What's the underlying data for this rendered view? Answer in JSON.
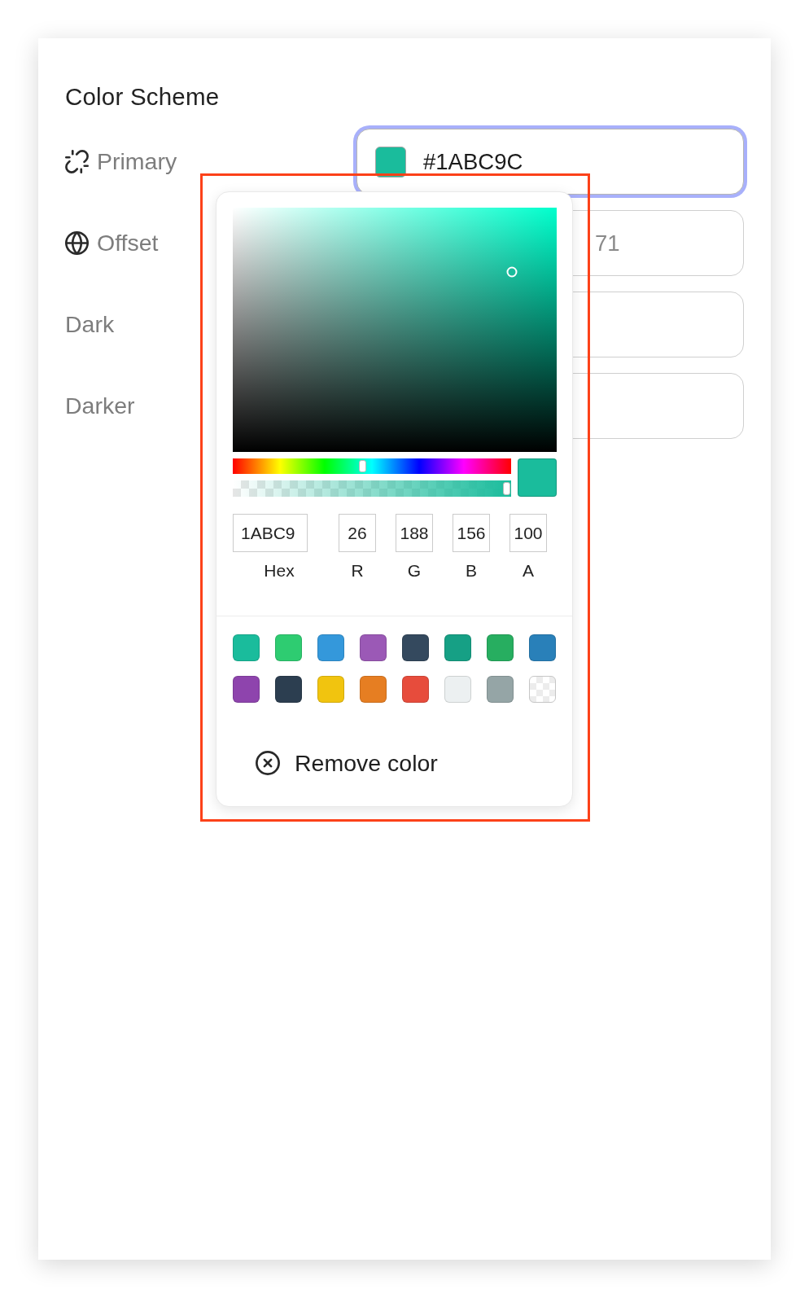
{
  "title": "Color Scheme",
  "fields": [
    {
      "label": "Primary",
      "focused": true,
      "color": "#1abc9c",
      "value": "#1ABC9C"
    },
    {
      "label": "Offset",
      "focused": false,
      "placeholder": "71"
    },
    {
      "label": "Dark",
      "focused": false
    },
    {
      "label": "Darker",
      "focused": false
    }
  ],
  "color_picker": {
    "hue": {
      "level": 0.467
    },
    "alpha": {
      "level": 1
    },
    "inputs": [
      {
        "kind": "hex",
        "value": "1ABC9",
        "label": "Hex"
      },
      {
        "kind": "channel",
        "value": "26",
        "label": "R"
      },
      {
        "kind": "channel",
        "value": "188",
        "label": "G"
      },
      {
        "kind": "channel",
        "value": "156",
        "label": "B"
      },
      {
        "kind": "channel",
        "value": "100",
        "label": "A"
      }
    ],
    "swatches": [
      {
        "kind": "solid",
        "color": "#1abc9c"
      },
      {
        "kind": "solid",
        "color": "#2ecc71"
      },
      {
        "kind": "solid",
        "color": "#3498db"
      },
      {
        "kind": "solid",
        "color": "#9b59b6"
      },
      {
        "kind": "solid",
        "color": "#34495e"
      },
      {
        "kind": "solid",
        "color": "#16a085"
      },
      {
        "kind": "solid",
        "color": "#27ae60"
      },
      {
        "kind": "solid",
        "color": "#2980b9"
      },
      {
        "kind": "solid",
        "color": "#8e44ad"
      },
      {
        "kind": "solid",
        "color": "#2c3e50"
      },
      {
        "kind": "solid",
        "color": "#f1c40f"
      },
      {
        "kind": "solid",
        "color": "#e67e22"
      },
      {
        "kind": "solid",
        "color": "#e74c3c"
      },
      {
        "kind": "solid",
        "color": "#ecf0f1"
      },
      {
        "kind": "solid",
        "color": "#95a5a6"
      },
      {
        "kind": "transparent"
      }
    ],
    "remove_button": "Remove color"
  },
  "annotation": {
    "kind": "highlight_frame"
  }
}
